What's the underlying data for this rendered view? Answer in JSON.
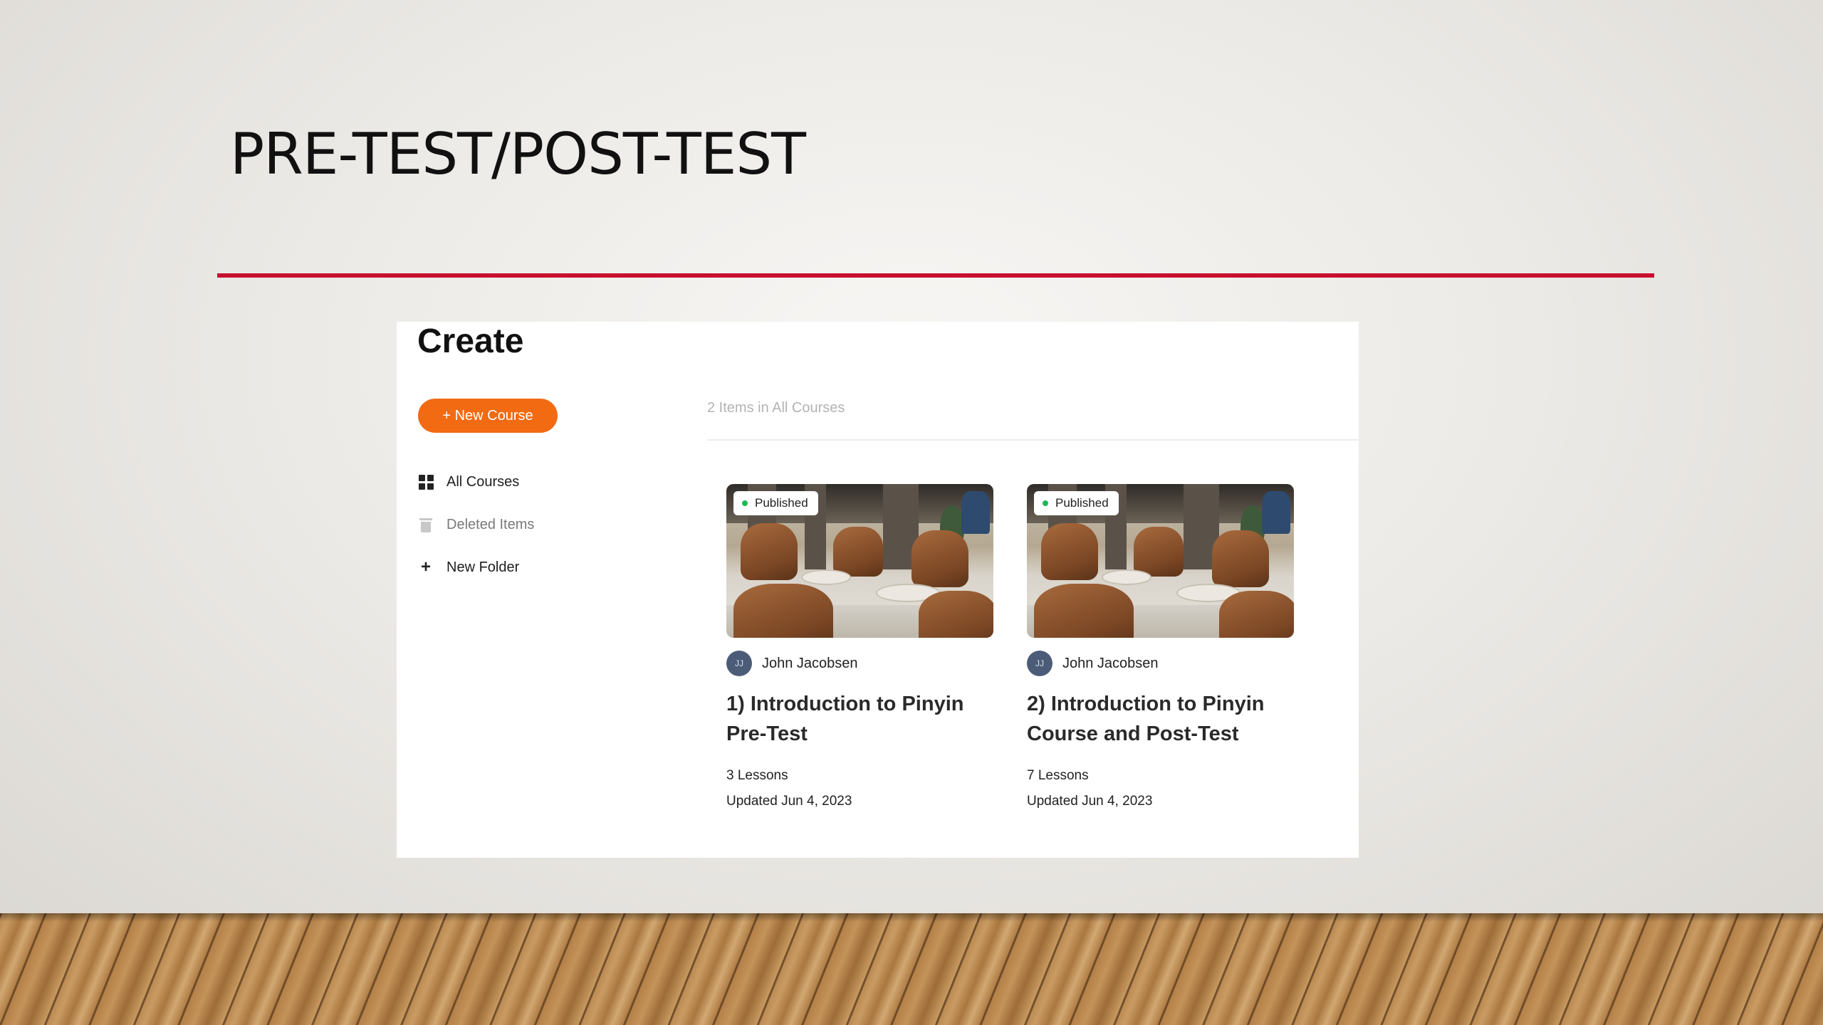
{
  "slide": {
    "title": "PRE-TEST/POST-TEST",
    "accent_color": "#c8102e"
  },
  "app": {
    "title": "Create",
    "new_course_button": "+ New Course",
    "brand_color": "#f26a12",
    "sidebar": {
      "items": [
        {
          "label": "All Courses",
          "icon": "grid-icon"
        },
        {
          "label": "Deleted Items",
          "icon": "trash-icon"
        },
        {
          "label": "New Folder",
          "icon": "plus-icon"
        }
      ]
    },
    "main": {
      "items_count": "2 Items in All Courses",
      "courses": [
        {
          "status": "Published",
          "author_initials": "JJ",
          "author": "John Jacobsen",
          "title": "1) Introduction to Pinyin Pre-Test",
          "lessons": "3 Lessons",
          "updated": "Updated Jun 4, 2023"
        },
        {
          "status": "Published",
          "author_initials": "JJ",
          "author": "John Jacobsen",
          "title": "2) Introduction to Pinyin Course and Post-Test",
          "lessons": "7 Lessons",
          "updated": "Updated Jun 4, 2023"
        }
      ]
    }
  }
}
